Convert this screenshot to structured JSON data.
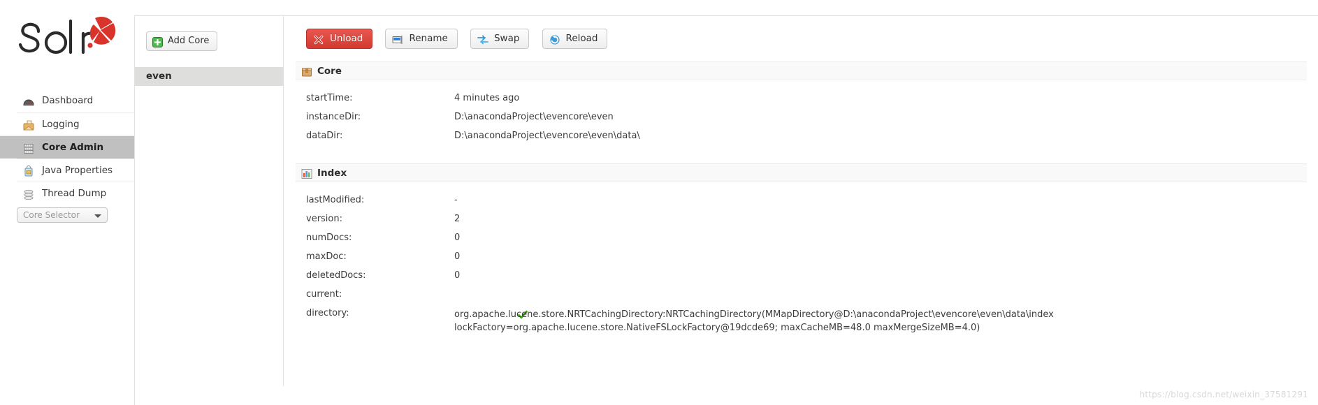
{
  "brand": {
    "name": "Solr",
    "logo_icon": "solr-logo"
  },
  "sidebar": {
    "items": [
      {
        "label": "Dashboard",
        "icon": "dashboard-icon",
        "active": false
      },
      {
        "label": "Logging",
        "icon": "logging-icon",
        "active": false
      },
      {
        "label": "Core Admin",
        "icon": "core-admin-icon",
        "active": true
      },
      {
        "label": "Java Properties",
        "icon": "java-properties-icon",
        "active": false
      },
      {
        "label": "Thread Dump",
        "icon": "thread-dump-icon",
        "active": false
      }
    ],
    "core_selector": {
      "placeholder": "Core Selector",
      "value": "Core Selector",
      "icon": "chevron-down-icon"
    }
  },
  "core_panel": {
    "add_core_label": "Add Core",
    "add_core_icon": "plus-icon",
    "cores": [
      {
        "name": "even",
        "selected": true
      }
    ]
  },
  "toolbar": {
    "buttons": [
      {
        "label": "Unload",
        "icon": "red-x-icon",
        "style": "danger"
      },
      {
        "label": "Rename",
        "icon": "rename-icon",
        "style": "default"
      },
      {
        "label": "Swap",
        "icon": "swap-icon",
        "style": "default"
      },
      {
        "label": "Reload",
        "icon": "reload-icon",
        "style": "default"
      }
    ]
  },
  "sections": {
    "core": {
      "title": "Core",
      "icon": "package-icon",
      "rows": [
        {
          "key": "startTime:",
          "value": "4 minutes ago"
        },
        {
          "key": "instanceDir:",
          "value": "D:\\anacondaProject\\evencore\\even"
        },
        {
          "key": "dataDir:",
          "value": "D:\\anacondaProject\\evencore\\even\\data\\"
        }
      ]
    },
    "index": {
      "title": "Index",
      "icon": "bar-chart-icon",
      "rows": [
        {
          "key": "lastModified:",
          "value": "-"
        },
        {
          "key": "version:",
          "value": "2"
        },
        {
          "key": "numDocs:",
          "value": "0"
        },
        {
          "key": "maxDoc:",
          "value": "0"
        },
        {
          "key": "deletedDocs:",
          "value": "0"
        },
        {
          "key": "current:",
          "value": "",
          "icon": "green-check-icon"
        },
        {
          "key": "directory:",
          "value": "org.apache.lucene.store.NRTCachingDirectory:NRTCachingDirectory(MMapDirectory@D:\\anacondaProject\\evencore\\even\\data\\index lockFactory=org.apache.lucene.store.NativeFSLockFactory@19dcde69; maxCacheMB=48.0 maxMergeSizeMB=4.0)"
        }
      ]
    }
  },
  "watermark": {
    "text": "https://blog.csdn.net/weixin_37581291"
  },
  "colors": {
    "accent_red": "#d33a31",
    "sidebar_active_bg": "#c0c0c0",
    "core_selected_bg": "#dededc",
    "section_head_bg": "#f9f9f9",
    "green_check": "#3aa30e"
  }
}
